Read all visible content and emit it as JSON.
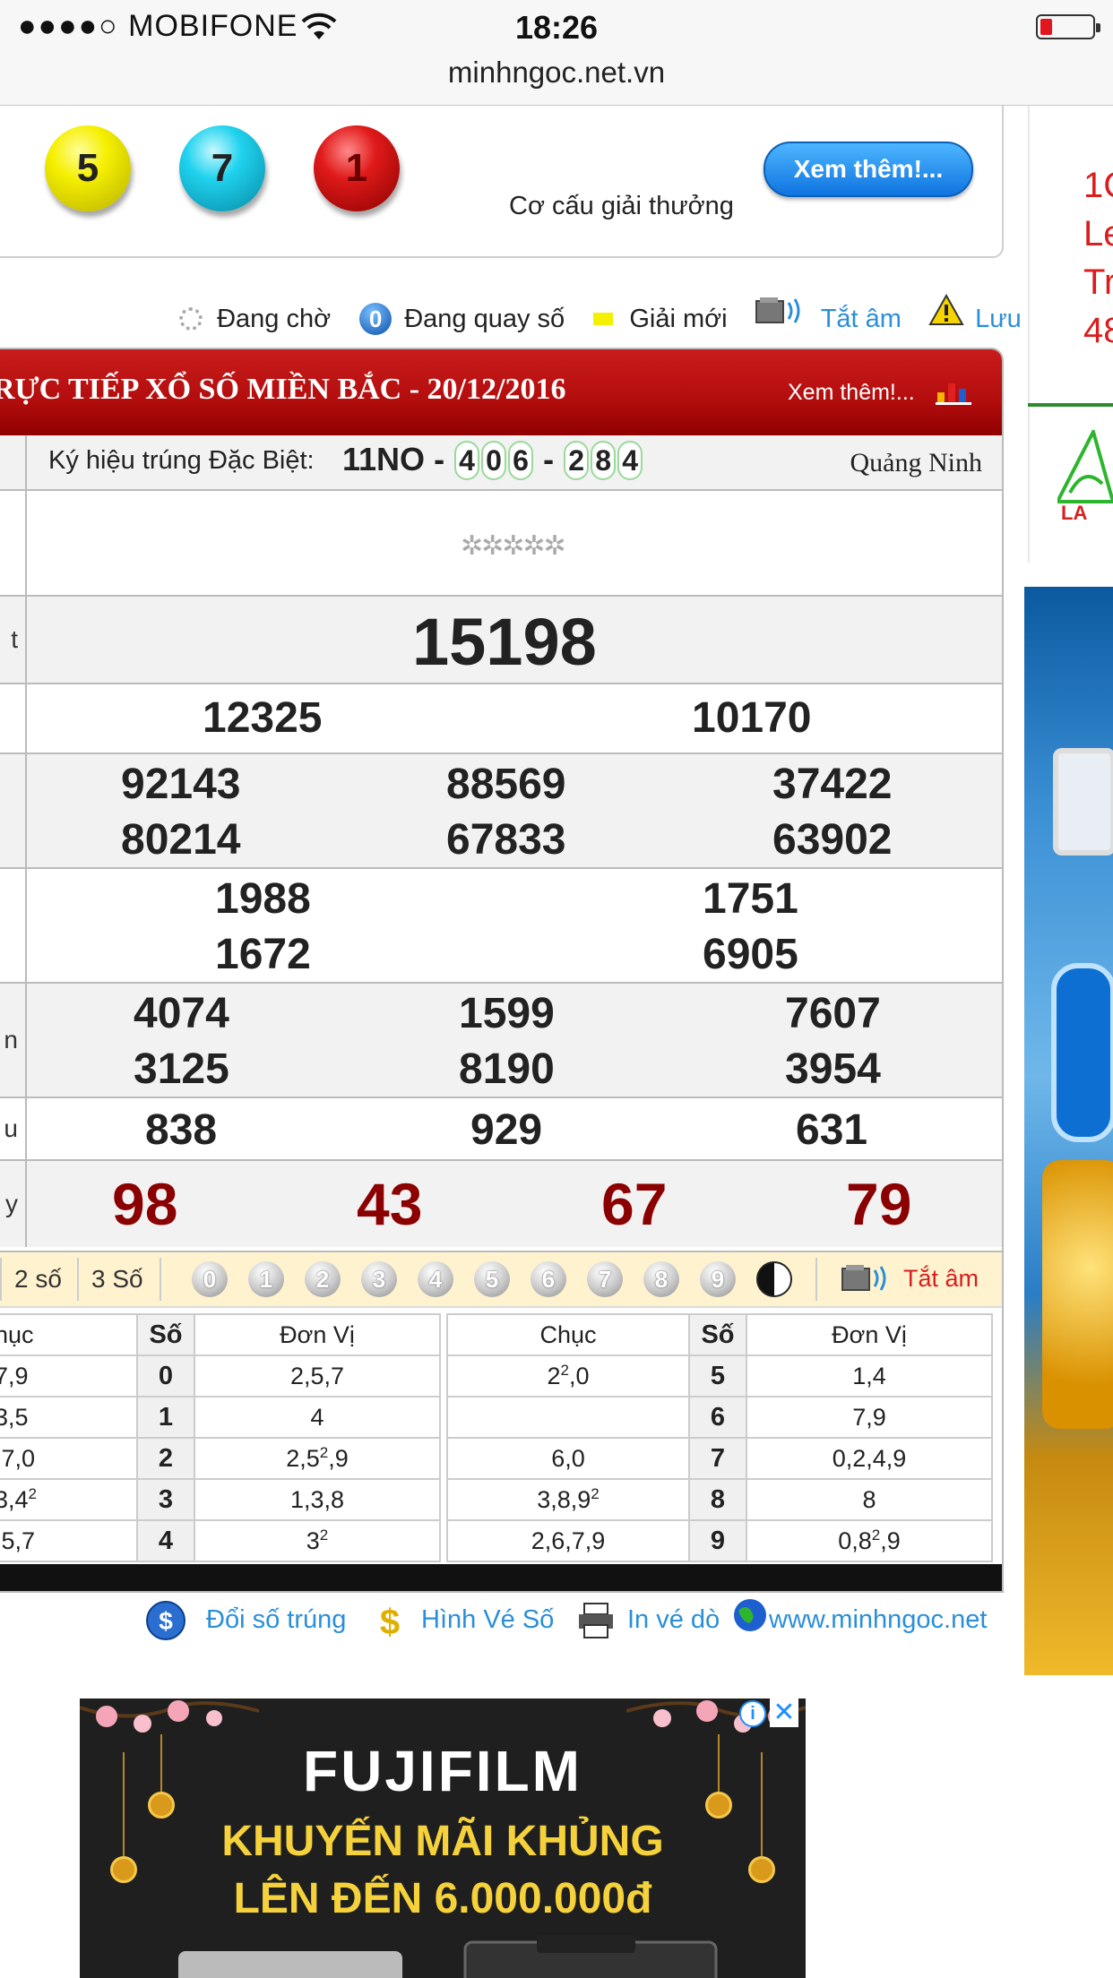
{
  "status_bar": {
    "carrier": "MOBIFONE",
    "signal_dots": "●●●●○",
    "time": "18:26"
  },
  "browser": {
    "url": "minhngoc.net.vn"
  },
  "balls_panel": {
    "balls": [
      "5",
      "7",
      "1"
    ],
    "structure_label": "Cơ cấu giải thưởng",
    "more_button": "Xem thêm!..."
  },
  "legend": {
    "waiting": "Đang chờ",
    "spinning_icon_digit": "0",
    "spinning": "Đang quay số",
    "new_prize": "Giải mới",
    "mute": "Tắt âm",
    "note": "Lưu ý"
  },
  "results": {
    "title": "RỰC TIẾP XỔ SỐ MIỀN BẮC - 20/12/2016",
    "more_link": "Xem thêm!...",
    "special_code_label": "Ký hiệu trúng Đặc Biệt:",
    "special_code_prefix": "11NO",
    "special_code_part1": [
      "4",
      "0",
      "6"
    ],
    "special_code_part2": [
      "2",
      "8",
      "4"
    ],
    "province": "Quảng Ninh",
    "waiting_mark": "✲✲✲✲✲",
    "row_labels": {
      "special": "t",
      "fourth": "n",
      "sixth": "u",
      "seventh": "y"
    },
    "special_prize": "15198",
    "prize1": [
      "12325",
      "10170"
    ],
    "prize2": [
      "92143",
      "88569",
      "37422",
      "80214",
      "67833",
      "63902"
    ],
    "prize3": [
      "1988",
      "1751",
      "1672",
      "6905"
    ],
    "prize4": [
      "4074",
      "1599",
      "7607",
      "3125",
      "8190",
      "3954"
    ],
    "prize5": [
      "838",
      "929",
      "631"
    ],
    "prize6": [
      "98",
      "43",
      "67",
      "79"
    ]
  },
  "selector": {
    "opt_2": "2 số",
    "opt_3": "3 Số",
    "digits": [
      "0",
      "1",
      "2",
      "3",
      "4",
      "5",
      "6",
      "7",
      "8",
      "9"
    ],
    "mute": "Tắt âm"
  },
  "loto": {
    "headers": {
      "chuc_left": "hục",
      "so": "Số",
      "donvi": "Đơn Vị",
      "chuc_right": "Chục"
    },
    "left_rows": [
      {
        "chuc": "7,9",
        "so": "0",
        "donvi": "2,5,7"
      },
      {
        "chuc": "3,5",
        "so": "1",
        "donvi": "4"
      },
      {
        "chuc": ",7,0",
        "so": "2",
        "donvi_base": "2,5",
        "donvi_sup": "2",
        "donvi_tail": ",9"
      },
      {
        "chuc_base": "3,4",
        "chuc_sup": "2",
        "so": "3",
        "donvi": "1,3,8"
      },
      {
        "chuc": ",5,7",
        "so": "4",
        "donvi_base": "3",
        "donvi_sup": "2"
      }
    ],
    "right_rows": [
      {
        "chuc_base": "2",
        "chuc_sup": "2",
        "chuc_tail": ",0",
        "so": "5",
        "donvi": "1,4"
      },
      {
        "chuc": "",
        "so": "6",
        "donvi": "7,9"
      },
      {
        "chuc": "6,0",
        "so": "7",
        "donvi": "0,2,4,9"
      },
      {
        "chuc_base": "3,8,9",
        "chuc_sup": "2",
        "so": "8",
        "donvi": "8"
      },
      {
        "chuc": "2,6,7,9",
        "so": "9",
        "donvi_base": "0,8",
        "donvi_sup": "2",
        "donvi_tail": ",9"
      }
    ]
  },
  "footer": {
    "doi_so": "Đổi số trúng",
    "hinh_ve": "Hình Vé Số",
    "in_ve": "In vé dò",
    "website": "www.minhngoc.net"
  },
  "ad": {
    "brand": "FUJIFILM",
    "line1": "KHUYẾN MÃI KHỦNG",
    "line2": "LÊN ĐẾN 6.000.000đ",
    "info_icon": "i",
    "close_icon": "✕"
  },
  "side": {
    "lines": [
      "1C",
      "Le",
      "Tr",
      "48"
    ]
  }
}
